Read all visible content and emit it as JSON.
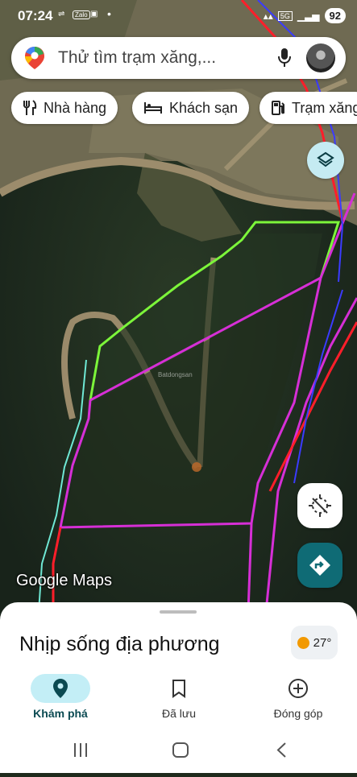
{
  "status_bar": {
    "time": "07:24",
    "indicators": [
      "Zalo"
    ],
    "network": "5G",
    "battery": "92"
  },
  "search": {
    "placeholder": "Thử tìm trạm xăng,..."
  },
  "chips": [
    {
      "label": "Nhà hàng",
      "icon": "restaurant-icon"
    },
    {
      "label": "Khách sạn",
      "icon": "hotel-icon"
    },
    {
      "label": "Trạm xăng",
      "icon": "gas-station-icon"
    }
  ],
  "map": {
    "logo_text": "Google Maps",
    "watermark": "Batdongsan",
    "boundary_colors": {
      "green": "#7cf53a",
      "magenta": "#d62fd6",
      "red": "#ff1e2a",
      "blue": "#3b3bff",
      "cyan": "#6fe8d4"
    }
  },
  "sheet": {
    "title": "Nhịp sống địa phương",
    "temperature": "27°"
  },
  "bottom_nav": [
    {
      "label": "Khám phá",
      "icon": "explore-pin-icon",
      "active": true
    },
    {
      "label": "Đã lưu",
      "icon": "bookmark-icon",
      "active": false
    },
    {
      "label": "Đóng góp",
      "icon": "add-circle-icon",
      "active": false
    }
  ],
  "accent_color": "#0f6b75"
}
